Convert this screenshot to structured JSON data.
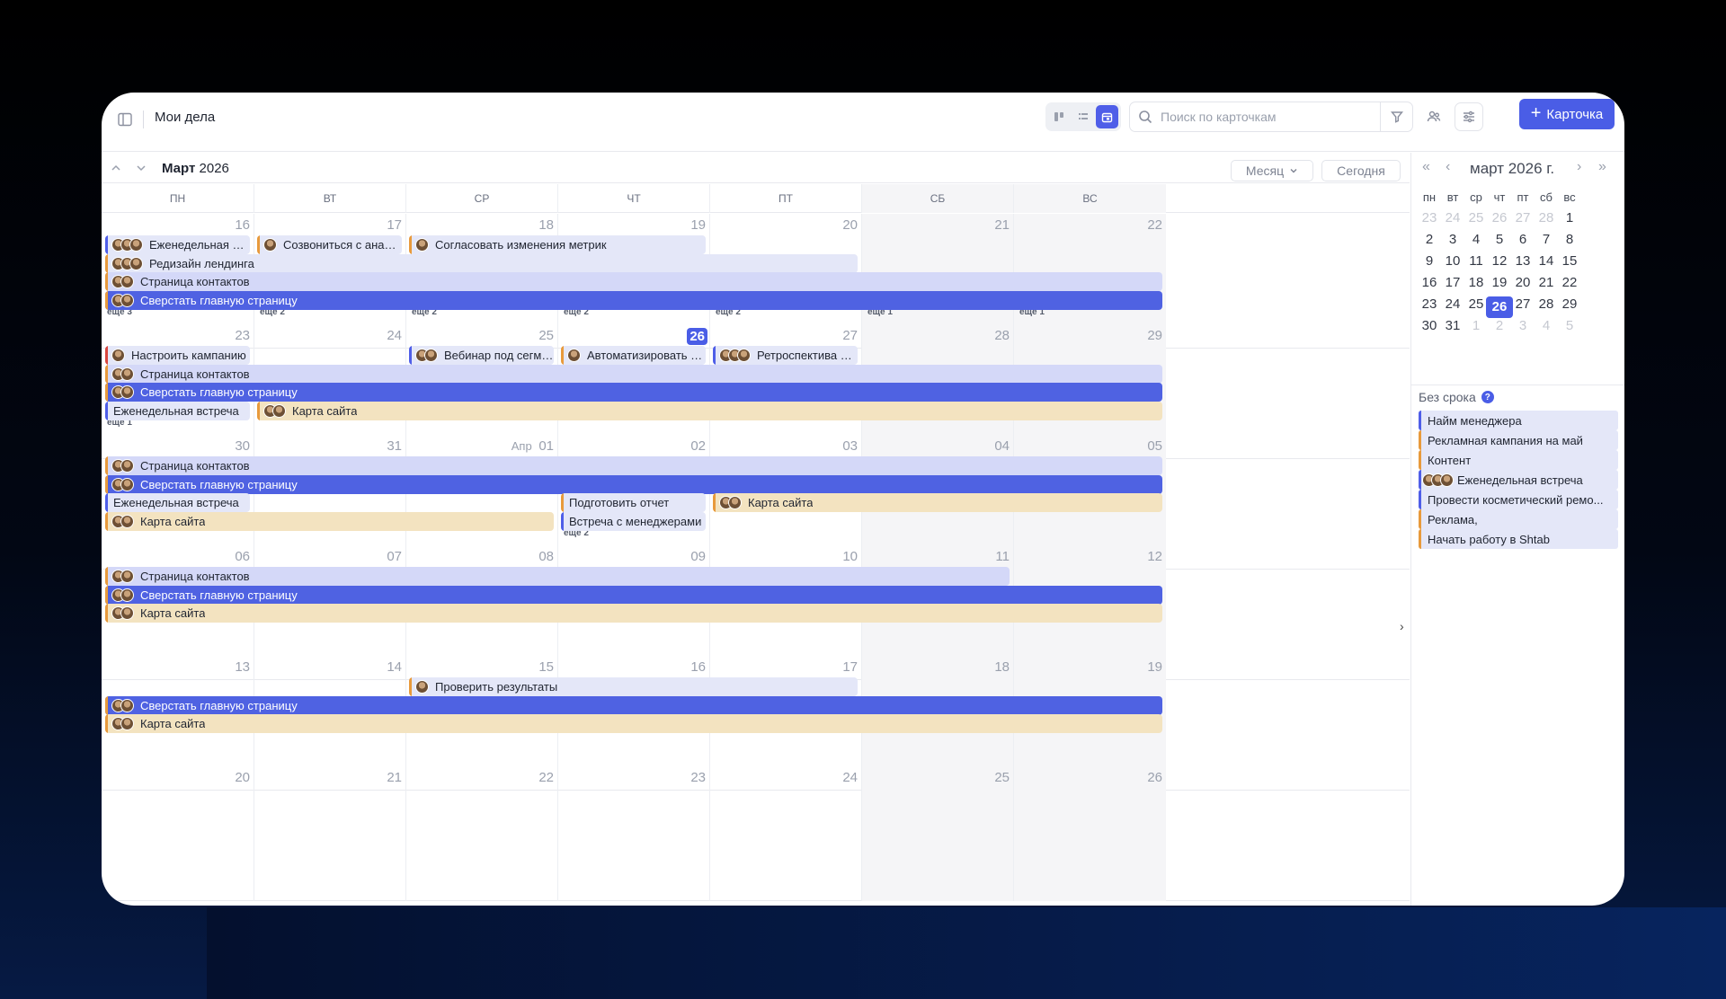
{
  "header": {
    "title": "Мои дела",
    "search_placeholder": "Поиск по карточкам",
    "add_button": "Карточка"
  },
  "toolbar": {
    "month_label_bold": "Март",
    "month_label_year": "2026",
    "view_select": "Месяц",
    "today_button": "Сегодня"
  },
  "weekdays": [
    "ПН",
    "ВТ",
    "СР",
    "ЧТ",
    "ПТ",
    "СБ",
    "ВС"
  ],
  "weeks": [
    {
      "days": [
        "16",
        "17",
        "18",
        "19",
        "20",
        "21",
        "22"
      ],
      "events": [
        {
          "title": "Еженедельная встреча",
          "col": 0,
          "span": 1,
          "row": 0,
          "color": "pale",
          "bar": "#4f5ee8",
          "avatars": 3
        },
        {
          "title": "Созвониться с аналитик...",
          "col": 1,
          "span": 1,
          "row": 0,
          "color": "pale",
          "bar": "#e89a3c",
          "avatars": 1
        },
        {
          "title": "Согласовать изменения метрик",
          "col": 2,
          "span": 2,
          "row": 0,
          "color": "pale",
          "bar": "#e89a3c",
          "avatars": 1
        },
        {
          "title": "Редизайн лендинга",
          "col": 0,
          "span": 5,
          "row": 1,
          "color": "pale",
          "bar": "#e89a3c",
          "avatars": 3
        },
        {
          "title": "Страница контактов",
          "col": 0,
          "span": 7,
          "row": 2,
          "color": "lav",
          "bar": "#e89a3c",
          "avatars": 2
        },
        {
          "title": "Сверстать главную страницу",
          "col": 0,
          "span": 7,
          "row": 3,
          "color": "blue",
          "bar": "#e89a3c",
          "avatars": 2
        }
      ],
      "more": [
        "еще 3",
        "еще 2",
        "еще 2",
        "еще 2",
        "еще 2",
        "еще 1",
        "еще 1"
      ]
    },
    {
      "days": [
        "23",
        "24",
        "25",
        "26",
        "27",
        "28",
        "29"
      ],
      "events": [
        {
          "title": "Настроить кампанию",
          "col": 0,
          "span": 1,
          "row": 0,
          "color": "pale",
          "bar": "#d9463e",
          "avatars": 1
        },
        {
          "title": "Вебинар под сегмент",
          "col": 2,
          "span": 1,
          "row": 0,
          "color": "pale",
          "bar": "#4f5ee8",
          "avatars": 2
        },
        {
          "title": "Автоматизировать расс...",
          "col": 3,
          "span": 1,
          "row": 0,
          "color": "pale",
          "bar": "#e89a3c",
          "avatars": 1
        },
        {
          "title": "Ретроспектива по пр...",
          "col": 4,
          "span": 1,
          "row": 0,
          "color": "pale",
          "bar": "#4f5ee8",
          "avatars": 3
        },
        {
          "title": "Страница контактов",
          "col": 0,
          "span": 7,
          "row": 1,
          "color": "lav",
          "bar": "#e89a3c",
          "avatars": 2
        },
        {
          "title": "Сверстать главную страницу",
          "col": 0,
          "span": 7,
          "row": 2,
          "color": "blue",
          "bar": "#e89a3c",
          "avatars": 2
        },
        {
          "title": "Еженедельная встреча",
          "col": 0,
          "span": 1,
          "row": 3,
          "color": "pale",
          "bar": "#4f5ee8",
          "avatars": 0
        },
        {
          "title": "Карта сайта",
          "col": 1,
          "span": 6,
          "row": 3,
          "color": "tan",
          "bar": "#e89a3c",
          "avatars": 2
        }
      ],
      "more": [
        "еще 1",
        "",
        "",
        "",
        "",
        "",
        ""
      ]
    },
    {
      "days": [
        "30",
        "31",
        "01",
        "02",
        "03",
        "04",
        "05"
      ],
      "month_prefix": "Апр",
      "events": [
        {
          "title": "Страница контактов",
          "col": 0,
          "span": 7,
          "row": 0,
          "color": "lav",
          "bar": "#e89a3c",
          "avatars": 2
        },
        {
          "title": "Сверстать главную страницу",
          "col": 0,
          "span": 7,
          "row": 1,
          "color": "blue",
          "bar": "#e89a3c",
          "avatars": 2
        },
        {
          "title": "Еженедельная встреча",
          "col": 0,
          "span": 1,
          "row": 2,
          "color": "pale",
          "bar": "#4f5ee8",
          "avatars": 0
        },
        {
          "title": "Подготовить отчет",
          "col": 3,
          "span": 1,
          "row": 2,
          "color": "pale",
          "bar": "#e89a3c",
          "avatars": 0
        },
        {
          "title": "Карта сайта",
          "col": 4,
          "span": 3,
          "row": 2,
          "color": "tan",
          "bar": "#e89a3c",
          "avatars": 2
        },
        {
          "title": "Карта сайта",
          "col": 0,
          "span": 3,
          "row": 3,
          "color": "tan",
          "bar": "#e89a3c",
          "avatars": 2
        },
        {
          "title": "Встреча с менеджерами",
          "col": 3,
          "span": 1,
          "row": 3,
          "color": "pale",
          "bar": "#4f5ee8",
          "avatars": 0
        }
      ],
      "more": [
        "",
        "",
        "",
        "еще 2",
        "",
        "",
        ""
      ]
    },
    {
      "days": [
        "06",
        "07",
        "08",
        "09",
        "10",
        "11",
        "12"
      ],
      "events": [
        {
          "title": "Страница контактов",
          "col": 0,
          "span": 6,
          "row": 0,
          "color": "lav",
          "bar": "#e89a3c",
          "avatars": 2
        },
        {
          "title": "Сверстать главную страницу",
          "col": 0,
          "span": 7,
          "row": 1,
          "color": "blue",
          "bar": "#e89a3c",
          "avatars": 2
        },
        {
          "title": "Карта сайта",
          "col": 0,
          "span": 7,
          "row": 2,
          "color": "tan",
          "bar": "#e89a3c",
          "avatars": 2
        }
      ],
      "more": [
        "",
        "",
        "",
        "",
        "",
        "",
        ""
      ]
    },
    {
      "days": [
        "13",
        "14",
        "15",
        "16",
        "17",
        "18",
        "19"
      ],
      "events": [
        {
          "title": "Проверить результаты",
          "col": 2,
          "span": 3,
          "row": 0,
          "color": "pale",
          "bar": "#e89a3c",
          "avatars": 1
        },
        {
          "title": "Сверстать главную страницу",
          "col": 0,
          "span": 7,
          "row": 1,
          "color": "blue",
          "bar": "#e89a3c",
          "avatars": 2
        },
        {
          "title": "Карта сайта",
          "col": 0,
          "span": 7,
          "row": 2,
          "color": "tan",
          "bar": "#e89a3c",
          "avatars": 2
        }
      ],
      "more": [
        "",
        "",
        "",
        "",
        "",
        "",
        ""
      ]
    },
    {
      "days": [
        "20",
        "21",
        "22",
        "23",
        "24",
        "25",
        "26"
      ],
      "events": [],
      "more": [
        "",
        "",
        "",
        "",
        "",
        "",
        ""
      ]
    }
  ],
  "today_marker": {
    "week": 1,
    "col": 3
  },
  "mini_calendar": {
    "title": "март 2026 г.",
    "weekdays": [
      "пн",
      "вт",
      "ср",
      "чт",
      "пт",
      "сб",
      "вс"
    ],
    "rows": [
      [
        {
          "d": "23",
          "m": true
        },
        {
          "d": "24",
          "m": true
        },
        {
          "d": "25",
          "m": true
        },
        {
          "d": "26",
          "m": true
        },
        {
          "d": "27",
          "m": true
        },
        {
          "d": "28",
          "m": true
        },
        {
          "d": "1",
          "m": false
        }
      ],
      [
        {
          "d": "2",
          "m": false
        },
        {
          "d": "3",
          "m": false
        },
        {
          "d": "4",
          "m": false
        },
        {
          "d": "5",
          "m": false
        },
        {
          "d": "6",
          "m": false
        },
        {
          "d": "7",
          "m": false
        },
        {
          "d": "8",
          "m": false
        }
      ],
      [
        {
          "d": "9",
          "m": false
        },
        {
          "d": "10",
          "m": false
        },
        {
          "d": "11",
          "m": false
        },
        {
          "d": "12",
          "m": false
        },
        {
          "d": "13",
          "m": false
        },
        {
          "d": "14",
          "m": false
        },
        {
          "d": "15",
          "m": false
        }
      ],
      [
        {
          "d": "16",
          "m": false
        },
        {
          "d": "17",
          "m": false
        },
        {
          "d": "18",
          "m": false
        },
        {
          "d": "19",
          "m": false
        },
        {
          "d": "20",
          "m": false
        },
        {
          "d": "21",
          "m": false
        },
        {
          "d": "22",
          "m": false
        }
      ],
      [
        {
          "d": "23",
          "m": false
        },
        {
          "d": "24",
          "m": false
        },
        {
          "d": "25",
          "m": false
        },
        {
          "d": "26",
          "m": false,
          "today": true
        },
        {
          "d": "27",
          "m": false
        },
        {
          "d": "28",
          "m": false
        },
        {
          "d": "29",
          "m": false
        }
      ],
      [
        {
          "d": "30",
          "m": false
        },
        {
          "d": "31",
          "m": false
        },
        {
          "d": "1",
          "m": true
        },
        {
          "d": "2",
          "m": true
        },
        {
          "d": "3",
          "m": true
        },
        {
          "d": "4",
          "m": true
        },
        {
          "d": "5",
          "m": true
        }
      ]
    ]
  },
  "no_due": {
    "title": "Без срока",
    "help": "?",
    "items": [
      {
        "title": "Найм менеджера",
        "bar": "#4f5ee8",
        "avatars": 0
      },
      {
        "title": "Рекламная кампания на май",
        "bar": "#e89a3c",
        "avatars": 0
      },
      {
        "title": "Контент",
        "bar": "#e89a3c",
        "avatars": 0
      },
      {
        "title": "Еженедельная встреча",
        "bar": "#4f5ee8",
        "avatars": 3
      },
      {
        "title": "Провести косметический ремо...",
        "bar": "#4f5ee8",
        "avatars": 0
      },
      {
        "title": "Реклама,",
        "bar": "#e89a3c",
        "avatars": 0
      },
      {
        "title": "Начать работу в Shtab",
        "bar": "#e89a3c",
        "avatars": 0
      }
    ]
  },
  "colors": {
    "accent": "#4a5de6",
    "event_blue": "#4f62e2",
    "event_lav": "#d4d8f8",
    "event_tan": "#f3e3c0",
    "event_pale": "#e4e7f8"
  }
}
